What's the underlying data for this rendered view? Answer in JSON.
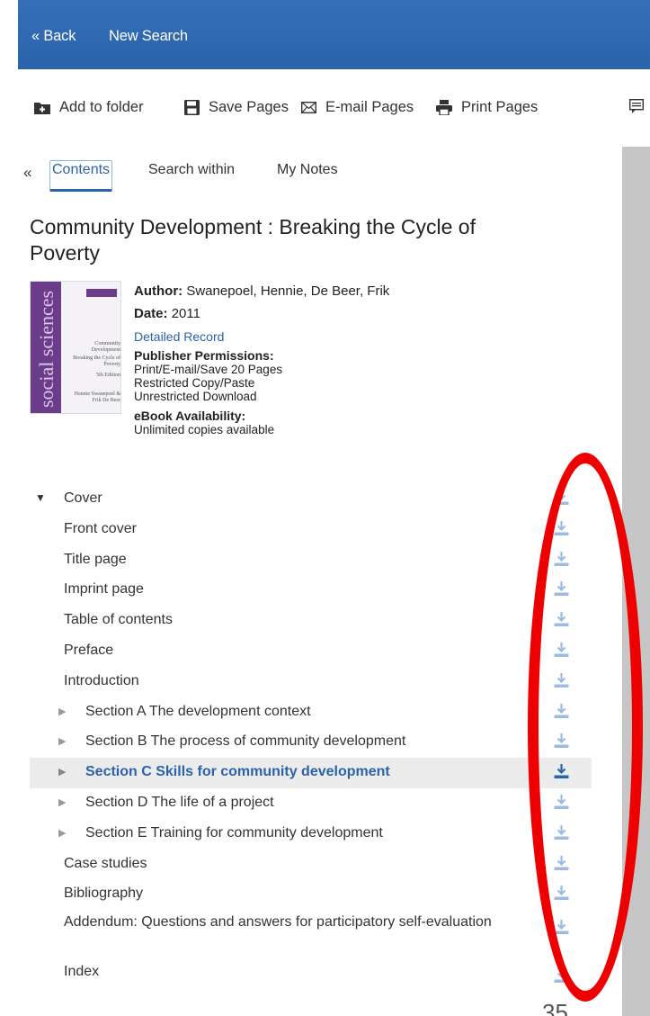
{
  "topbar": {
    "back": "« Back",
    "new_search": "New Search",
    "color": "#2b63aa"
  },
  "toolbar": {
    "add_to_folder": "Add to folder",
    "save_pages": "Save Pages",
    "email_pages": "E-mail Pages",
    "print_pages": "Print Pages"
  },
  "tabs": {
    "collapse": "«",
    "contents": "Contents",
    "search_within": "Search within",
    "my_notes": "My Notes"
  },
  "book": {
    "title": "Community Development : Breaking the Cycle of Poverty",
    "author_label": "Author:",
    "author": "Swanepoel, Hennie, De Beer, Frik",
    "date_label": "Date:",
    "date": "2011",
    "detailed_record": "Detailed Record",
    "permissions_label": "Publisher Permissions:",
    "permissions": [
      "Print/E-mail/Save 20 Pages",
      "Restricted Copy/Paste",
      "Unrestricted Download"
    ],
    "availability_label": "eBook Availability:",
    "availability": "Unlimited copies available",
    "cover": {
      "spine_text": "social sciences",
      "title": "Community Development",
      "subtitle": "Breaking the Cycle of Poverty",
      "edition": "5th Edition",
      "authors": "Hennie Swanepoel & Frik De Beer"
    }
  },
  "toc": [
    {
      "label": "Cover",
      "level": 0,
      "expanded": true
    },
    {
      "label": "Front cover",
      "level": 1
    },
    {
      "label": "Title page",
      "level": 1
    },
    {
      "label": "Imprint page",
      "level": 1
    },
    {
      "label": "Table of contents",
      "level": 1
    },
    {
      "label": "Preface",
      "level": 1
    },
    {
      "label": "Introduction",
      "level": 1
    },
    {
      "label": "Section A The development context",
      "level": 2
    },
    {
      "label": "Section B The process of community development",
      "level": 2
    },
    {
      "label": "Section C Skills for community development",
      "level": 2,
      "active": true
    },
    {
      "label": "Section D The life of a project",
      "level": 2
    },
    {
      "label": "Section E Training for community development",
      "level": 2
    },
    {
      "label": "Case studies",
      "level": 1
    },
    {
      "label": "Bibliography",
      "level": 1
    },
    {
      "label": "Addendum: Questions and answers for participatory self-evaluation",
      "level": 1
    },
    {
      "label": "Index",
      "level": 1
    }
  ],
  "colors": {
    "accent": "#2b63aa",
    "annotation": "#ee0000",
    "download_icon": "#9bbce0",
    "download_icon_active": "#2b63aa"
  },
  "slide_page_number": "35"
}
